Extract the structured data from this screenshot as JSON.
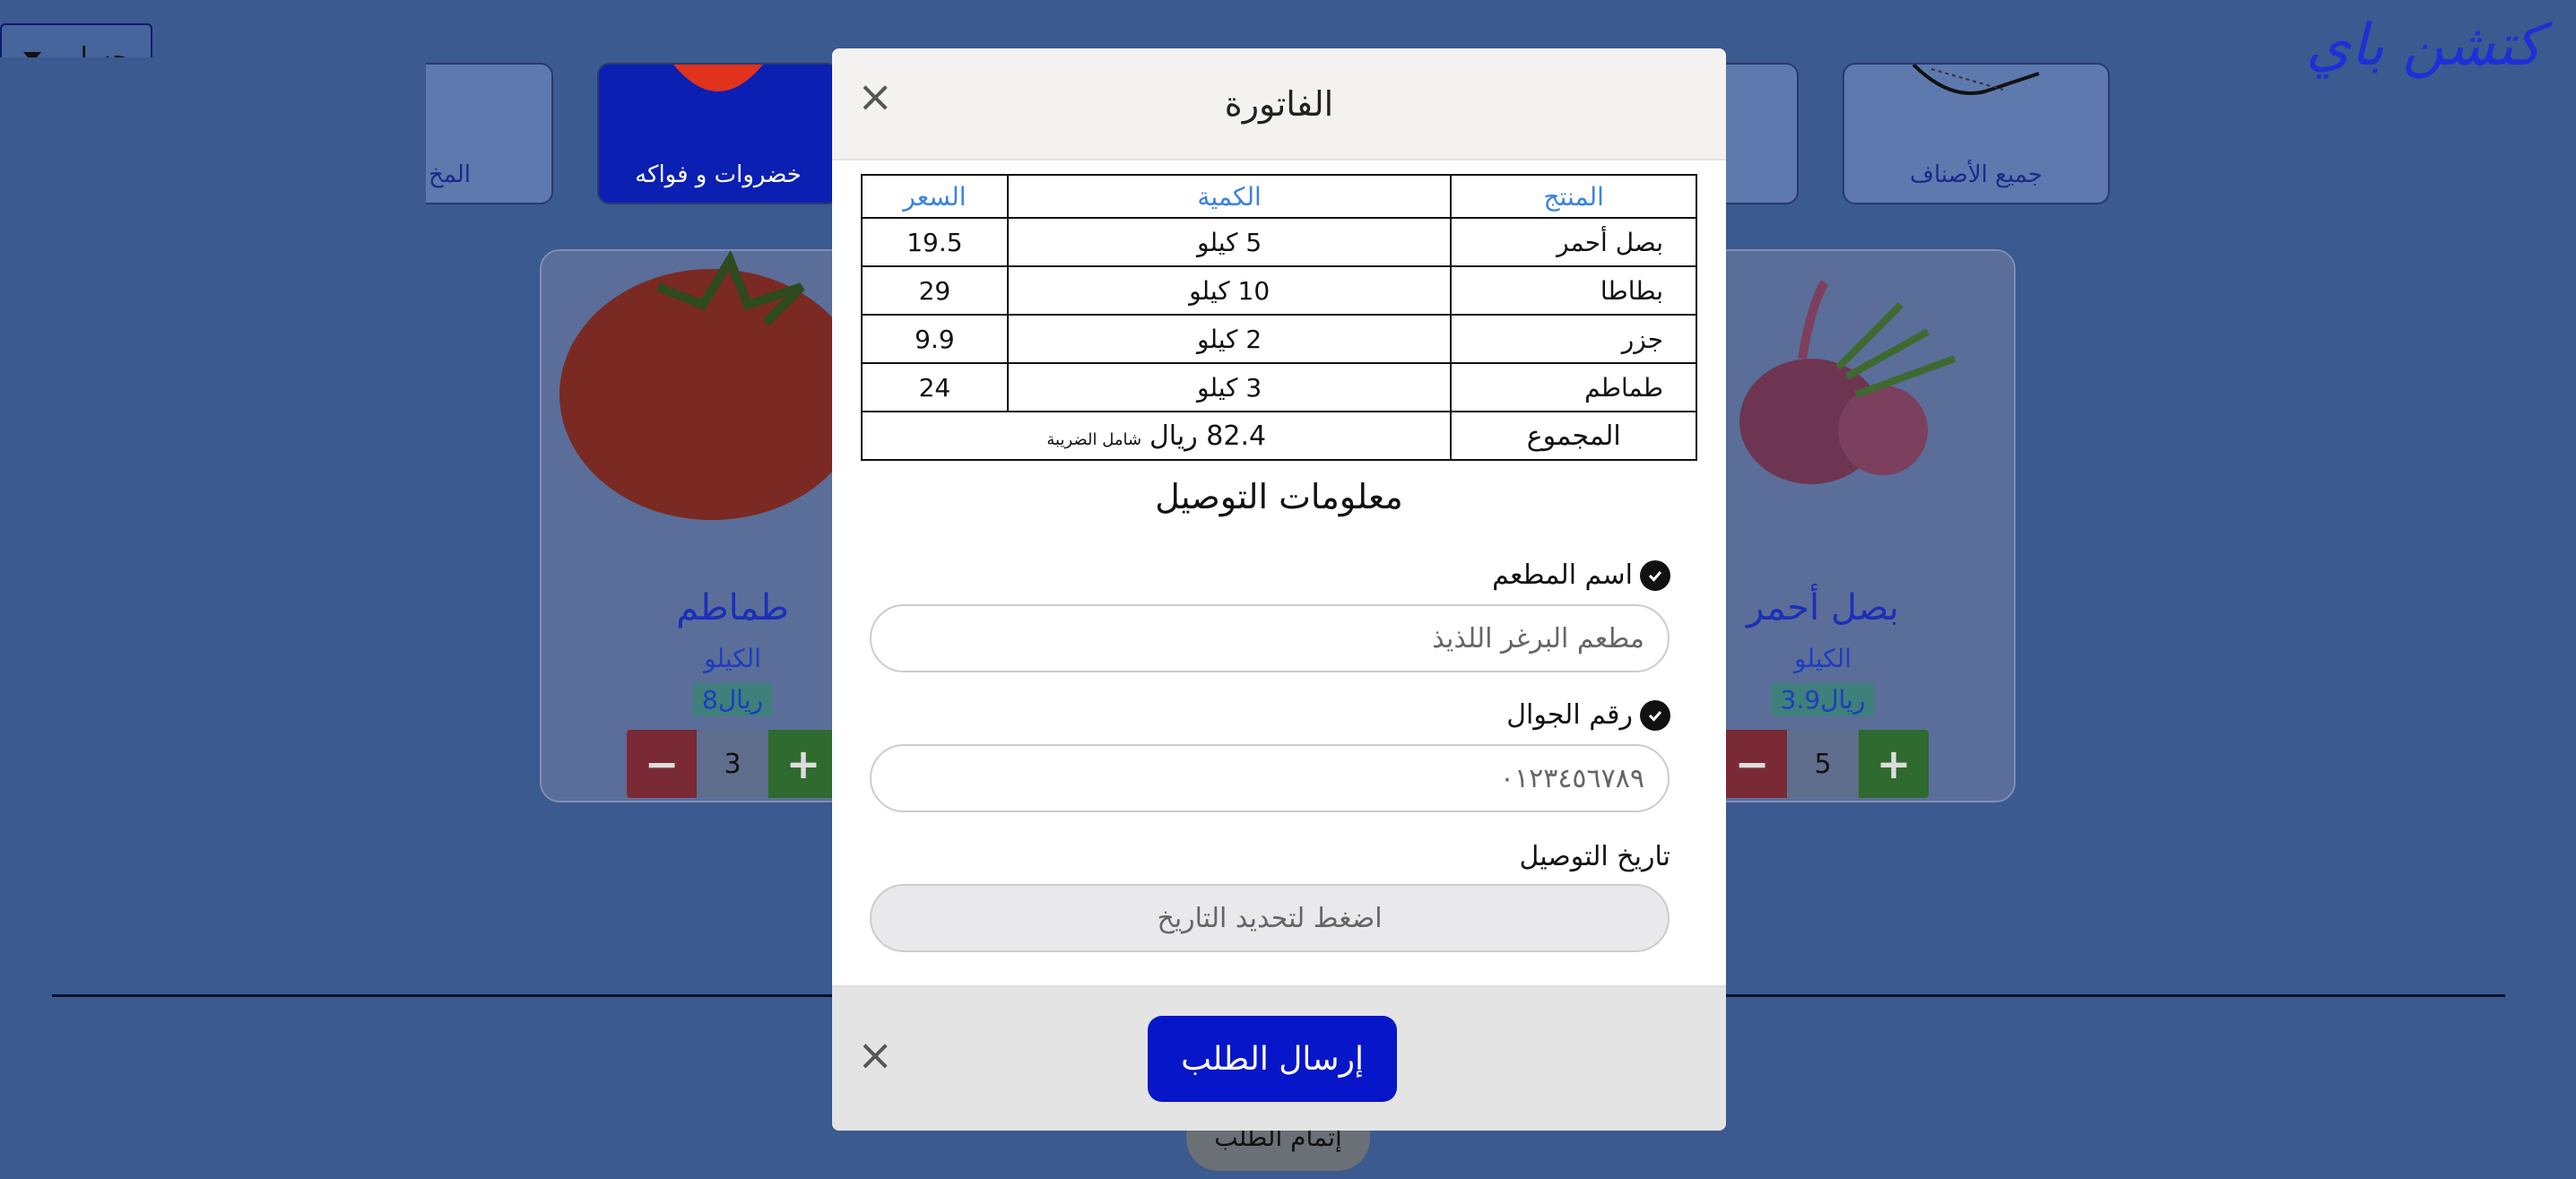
{
  "header": {
    "brand": "كتشن باي",
    "account_label": "حسابي"
  },
  "categories": [
    {
      "label": "جميع الأصناف"
    },
    {
      "label": "خضروات و فواكه"
    },
    {
      "label": "المخ"
    }
  ],
  "products": [
    {
      "name": "بصل أحمر",
      "unit": "الكيلو",
      "price": "3.9ريال",
      "qty": "5"
    },
    {
      "name": "طماطم",
      "unit": "الكيلو",
      "price": "8ريال",
      "qty": "3"
    }
  ],
  "complete_order_label": "إتمام الطلب",
  "modal": {
    "title": "الفاتورة",
    "invoice": {
      "headers": {
        "product": "المنتج",
        "quantity": "الكمية",
        "price": "السعر"
      },
      "rows": [
        {
          "product": "بصل أحمر",
          "quantity": "5 كيلو",
          "price": "19.5"
        },
        {
          "product": "بطاطا",
          "quantity": "10 كيلو",
          "price": "29"
        },
        {
          "product": "جزر",
          "quantity": "2 كيلو",
          "price": "9.9"
        },
        {
          "product": "طماطم",
          "quantity": "3 كيلو",
          "price": "24"
        }
      ],
      "total_label": "المجموع",
      "total_value": "82.4 ريال",
      "tax_note": "شامل الضريبة"
    },
    "delivery_title": "معلومات التوصيل",
    "restaurant_label": "اسم المطعم",
    "restaurant_placeholder": "مطعم البرغر اللذيذ",
    "phone_label": "رقم الجوال",
    "phone_placeholder": "٠١٢٣٤٥٦٧٨٩",
    "date_label": "تاريخ التوصيل",
    "date_placeholder": "اضغط لتحديد التاريخ",
    "submit_label": "إرسال الطلب"
  }
}
